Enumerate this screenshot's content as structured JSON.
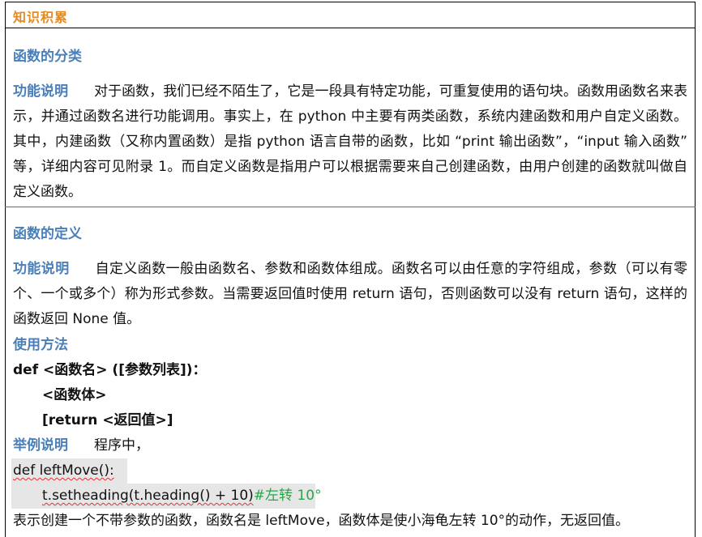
{
  "header": {
    "title": "知识积累"
  },
  "section1": {
    "title": "函数的分类",
    "label": "功能说明",
    "text": "对于函数，我们已经不陌生了，它是一段具有特定功能，可重复使用的语句块。函数用函数名来表示，并通过函数名进行功能调用。事实上，在 python 中主要有两类函数，系统内建函数和用户自定义函数。其中，内建函数（又称内置函数）是指 python 语言自带的函数，比如 “print 输出函数”，“input 输入函数” 等，详细内容可见附录 1。而自定义函数是指用户可以根据需要来自己创建函数，由用户创建的函数就叫做自定义函数。"
  },
  "section2": {
    "title": "函数的定义",
    "label": "功能说明",
    "text": "自定义函数一般由函数名、参数和函数体组成。函数名可以由任意的字符组成，参数（可以有零个、一个或多个）称为形式参数。当需要返回值时使用 return 语句，否则函数可以没有 return 语句，这样的函数返回 None 值。",
    "usage_label": "使用方法",
    "syntax_line1": "def <函数名>  ([参数列表])：",
    "syntax_line2": "<函数体>",
    "syntax_line3": "[return <返回值>]",
    "example_label": "举例说明",
    "example_text": "程序中，",
    "code_line1": "def leftMove():",
    "code_line2_code": "t.setheading(t.heading() + 10)",
    "code_line2_comment": "#左转 10°",
    "explain_text": "表示创建一个不带参数的函数，函数名是 leftMove，函数体是使小海龟左转 10°的动作，无返回值。"
  }
}
